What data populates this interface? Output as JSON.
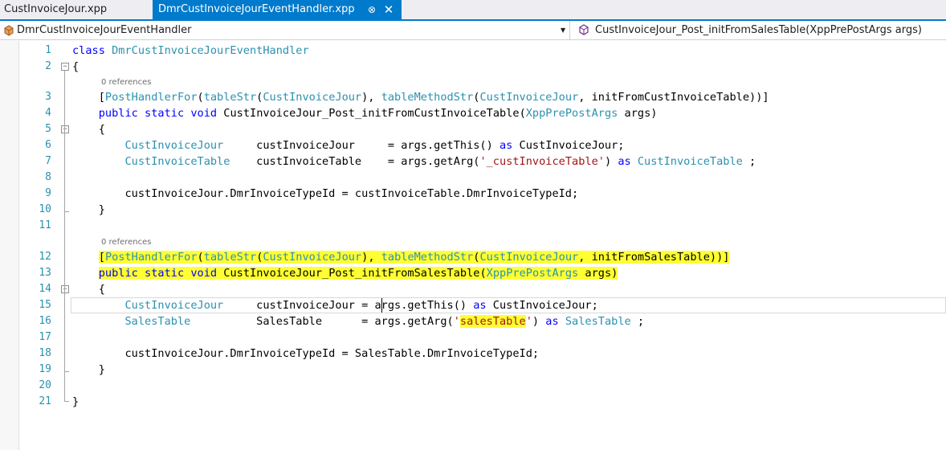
{
  "tabs": [
    {
      "label": "CustInvoiceJour.xpp",
      "active": false
    },
    {
      "label": "DmrCustInvoiceJourEventHandler.xpp",
      "active": true
    }
  ],
  "tab_icons": {
    "pin": "pin-icon",
    "close": "close-icon"
  },
  "navbar": {
    "class_name": "DmrCustInvoiceJourEventHandler",
    "member_name": "CustInvoiceJour_Post_initFromSalesTable(XppPrePostArgs args)"
  },
  "code_lens": [
    "0 references",
    "0 references"
  ],
  "colors": {
    "accent": "#007acc",
    "keyword": "#0000ff",
    "type": "#2b91af",
    "string": "#a31515",
    "highlight": "#ffff33",
    "line_number": "#2b91af"
  },
  "lines": [
    {
      "num": "1",
      "tokens": [
        {
          "t": "class",
          "c": "kw"
        },
        {
          "t": " "
        },
        {
          "t": "DmrCustInvoiceJourEventHandler",
          "c": "ty"
        }
      ]
    },
    {
      "num": "2",
      "tokens": [
        {
          "t": "{"
        }
      ]
    },
    {
      "num": "3",
      "tokens": [
        {
          "t": "    ["
        },
        {
          "t": "PostHandlerFor",
          "c": "ty"
        },
        {
          "t": "("
        },
        {
          "t": "tableStr",
          "c": "ty"
        },
        {
          "t": "("
        },
        {
          "t": "CustInvoiceJour",
          "c": "ty"
        },
        {
          "t": "), "
        },
        {
          "t": "tableMethodStr",
          "c": "ty"
        },
        {
          "t": "("
        },
        {
          "t": "CustInvoiceJour",
          "c": "ty"
        },
        {
          "t": ", initFromCustInvoiceTable))]"
        }
      ]
    },
    {
      "num": "4",
      "tokens": [
        {
          "t": "    "
        },
        {
          "t": "public",
          "c": "kw"
        },
        {
          "t": " "
        },
        {
          "t": "static",
          "c": "kw"
        },
        {
          "t": " "
        },
        {
          "t": "void",
          "c": "kw"
        },
        {
          "t": " CustInvoiceJour_Post_initFromCustInvoiceTable("
        },
        {
          "t": "XppPrePostArgs",
          "c": "ty"
        },
        {
          "t": " args)"
        }
      ]
    },
    {
      "num": "5",
      "tokens": [
        {
          "t": "    {"
        }
      ]
    },
    {
      "num": "6",
      "tokens": [
        {
          "t": "        "
        },
        {
          "t": "CustInvoiceJour",
          "c": "ty"
        },
        {
          "t": "     custInvoiceJour     = args.getThis() "
        },
        {
          "t": "as",
          "c": "kw"
        },
        {
          "t": " CustInvoiceJour;"
        }
      ]
    },
    {
      "num": "7",
      "tokens": [
        {
          "t": "        "
        },
        {
          "t": "CustInvoiceTable",
          "c": "ty"
        },
        {
          "t": "    custInvoiceTable    = args.getArg("
        },
        {
          "t": "'_custInvoiceTable'",
          "c": "st"
        },
        {
          "t": ") "
        },
        {
          "t": "as",
          "c": "kw"
        },
        {
          "t": " "
        },
        {
          "t": "CustInvoiceTable",
          "c": "ty"
        },
        {
          "t": " ;"
        }
      ]
    },
    {
      "num": "8",
      "tokens": [
        {
          "t": ""
        }
      ]
    },
    {
      "num": "9",
      "tokens": [
        {
          "t": "        custInvoiceJour.DmrInvoiceTypeId = custInvoiceTable.DmrInvoiceTypeId;"
        }
      ]
    },
    {
      "num": "10",
      "tokens": [
        {
          "t": "    }"
        }
      ]
    },
    {
      "num": "11",
      "tokens": [
        {
          "t": ""
        }
      ]
    },
    {
      "num": "12",
      "tokens": [
        {
          "t": "    "
        },
        {
          "t": "[",
          "h": true
        },
        {
          "t": "PostHandlerFor",
          "c": "ty",
          "h": true
        },
        {
          "t": "(",
          "h": true
        },
        {
          "t": "tableStr",
          "c": "ty",
          "h": true
        },
        {
          "t": "(",
          "h": true
        },
        {
          "t": "CustInvoiceJour",
          "c": "ty",
          "h": true
        },
        {
          "t": "), ",
          "h": true
        },
        {
          "t": "tableMethodStr",
          "c": "ty",
          "h": true
        },
        {
          "t": "(",
          "h": true
        },
        {
          "t": "CustInvoiceJour",
          "c": "ty",
          "h": true
        },
        {
          "t": ", initFromSalesTable))]",
          "h": true
        }
      ]
    },
    {
      "num": "13",
      "tokens": [
        {
          "t": "    "
        },
        {
          "t": "public",
          "c": "kw",
          "h": true
        },
        {
          "t": " ",
          "h": true
        },
        {
          "t": "static",
          "c": "kw",
          "h": true
        },
        {
          "t": " ",
          "h": true
        },
        {
          "t": "void",
          "c": "kw",
          "h": true
        },
        {
          "t": " CustInvoiceJour_Post_initFromSalesTable(",
          "h": true
        },
        {
          "t": "XppPrePostArgs",
          "c": "ty",
          "h": true
        },
        {
          "t": " args)",
          "h": true
        }
      ]
    },
    {
      "num": "14",
      "tokens": [
        {
          "t": "    {"
        }
      ]
    },
    {
      "num": "15",
      "tokens": [
        {
          "t": "        "
        },
        {
          "t": "CustInvoiceJour",
          "c": "ty"
        },
        {
          "t": "     custInvoiceJour = args.getThis() "
        },
        {
          "t": "as",
          "c": "kw"
        },
        {
          "t": " CustInvoiceJour;"
        }
      ]
    },
    {
      "num": "16",
      "tokens": [
        {
          "t": "        "
        },
        {
          "t": "SalesTable",
          "c": "ty"
        },
        {
          "t": "          SalesTable      = args.getArg("
        },
        {
          "t": "'",
          "c": "st"
        },
        {
          "t": "salesTable",
          "c": "st",
          "h": true
        },
        {
          "t": "'",
          "c": "st"
        },
        {
          "t": ") "
        },
        {
          "t": "as",
          "c": "kw"
        },
        {
          "t": " "
        },
        {
          "t": "SalesTable",
          "c": "ty"
        },
        {
          "t": " ;"
        }
      ]
    },
    {
      "num": "17",
      "tokens": [
        {
          "t": ""
        }
      ]
    },
    {
      "num": "18",
      "tokens": [
        {
          "t": "        custInvoiceJour.DmrInvoiceTypeId = SalesTable.DmrInvoiceTypeId;"
        }
      ]
    },
    {
      "num": "19",
      "tokens": [
        {
          "t": "    }"
        }
      ]
    },
    {
      "num": "20",
      "tokens": [
        {
          "t": ""
        }
      ]
    },
    {
      "num": "21",
      "tokens": [
        {
          "t": "}"
        }
      ]
    }
  ]
}
